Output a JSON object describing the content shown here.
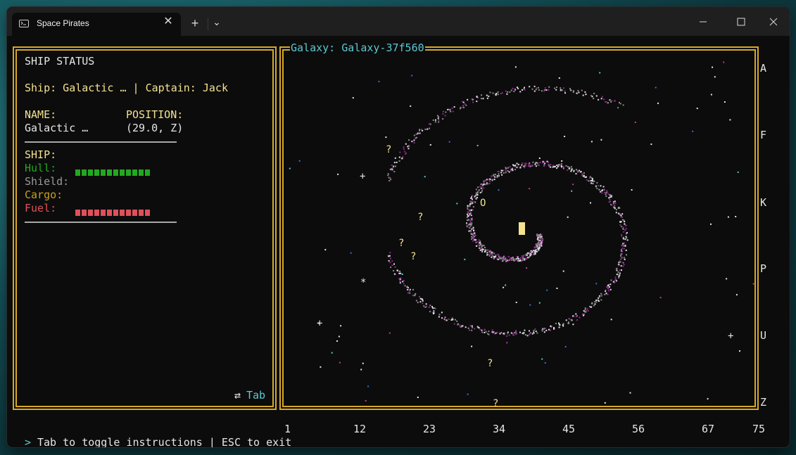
{
  "window": {
    "tab_title": "Space Pirates",
    "new_tab_symbol": "+",
    "dropdown_symbol": "⌄",
    "close_tab_symbol": "✕"
  },
  "status_panel": {
    "heading": "SHIP STATUS",
    "ship_line": "Ship: Galactic … | Captain: Jack",
    "name_label": "NAME:",
    "name_value": "Galactic …",
    "position_label": "POSITION:",
    "position_value": "(29.0, Z)",
    "ship_section_label": "SHIP:",
    "meters": [
      {
        "label": "Hull:",
        "color": "#22a91f",
        "level": 1.0
      },
      {
        "label": "Shield:",
        "color": "#9a9a9a",
        "level": 0.0
      },
      {
        "label": "Cargo:",
        "color": "#c7a11a",
        "level": 0.0
      },
      {
        "label": "Fuel:",
        "color": "#e0505a",
        "level": 1.0
      }
    ],
    "toggle_icon": "⇄",
    "toggle_label": "Tab"
  },
  "galaxy_panel": {
    "title": "Galaxy: Galaxy-37f560",
    "row_labels": [
      "A",
      "F",
      "K",
      "P",
      "U",
      "Z"
    ],
    "col_labels": [
      "1",
      "12",
      "23",
      "34",
      "45",
      "56",
      "67",
      "75"
    ],
    "ship_marker_color": "#f3e28f",
    "unknown_marker": "?",
    "star_marker": "*",
    "plus_marker": "+",
    "o_marker": "O"
  },
  "footer": {
    "prompt": ">",
    "instructions": "Tab to toggle instructions | ESC to exit"
  },
  "colors": {
    "border": "#d6a728",
    "arm_purple": "#8a2a8a",
    "arm_gray": "#8c8c8c",
    "arm_white": "#e0e0e0"
  }
}
